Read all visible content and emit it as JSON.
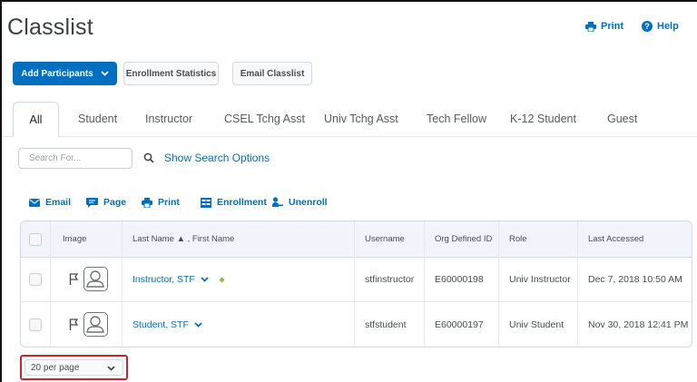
{
  "page": {
    "title": "Classlist"
  },
  "header_links": [
    {
      "label": "Print",
      "icon": "printer-icon"
    },
    {
      "label": "Help",
      "icon": "help-circle-icon"
    }
  ],
  "buttons": {
    "add_participants": "Add Participants",
    "enrollment_statistics": "Enrollment Statistics",
    "email_classlist": "Email Classlist"
  },
  "tabs": [
    "All",
    "Student",
    "Instructor",
    "CSEL Tchg Asst",
    "Univ Tchg Asst",
    "Tech Fellow",
    "K-12 Student",
    "Guest"
  ],
  "active_tab": "All",
  "search": {
    "placeholder": "Search For...",
    "options_label": "Show Search Options"
  },
  "actions": [
    {
      "label": "Email",
      "icon": "envelope-icon"
    },
    {
      "label": "Page",
      "icon": "chat-icon"
    },
    {
      "label": "Print",
      "icon": "printer-icon"
    },
    {
      "label": "Enrollment",
      "icon": "enrollment-icon"
    },
    {
      "label": "Unenroll",
      "icon": "unenroll-icon"
    }
  ],
  "table": {
    "headers": {
      "image": "Image",
      "name": "Last Name ▲ , First Name",
      "username": "Username",
      "org_id": "Org Defined ID",
      "role": "Role",
      "last_accessed": "Last Accessed"
    },
    "rows": [
      {
        "name": "Instructor, STF",
        "username": "stfinstructor",
        "org_id": "E60000198",
        "role": "Univ Instructor",
        "last_accessed": "Dec 7, 2018 10:50 AM",
        "online": true
      },
      {
        "name": "Student, STF",
        "username": "stfstudent",
        "org_id": "E60000197",
        "role": "Univ Student",
        "last_accessed": "Nov 30, 2018 12:41 PM",
        "online": false
      }
    ]
  },
  "pager": {
    "value": "20 per page"
  },
  "colors": {
    "accent": "#006fbf",
    "highlight": "#c4262e",
    "online": "#8bc34a"
  }
}
